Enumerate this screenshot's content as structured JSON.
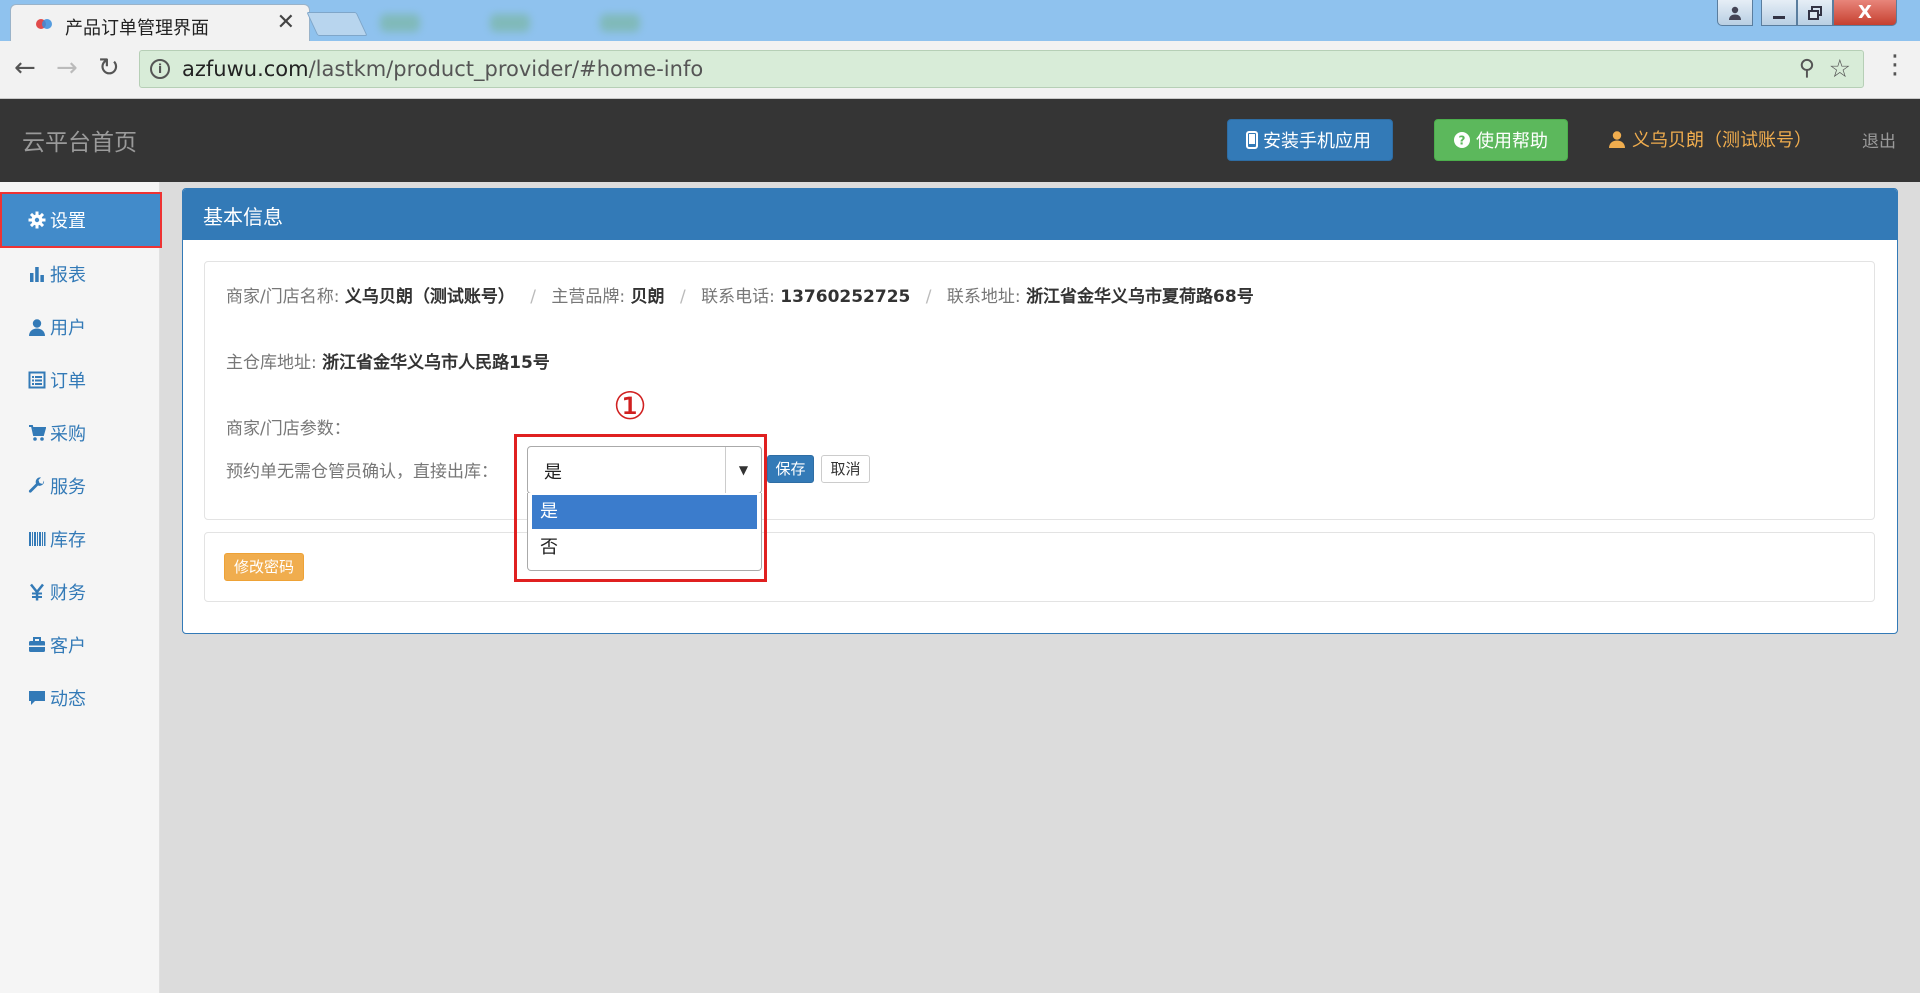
{
  "browser": {
    "tab_title": "产品订单管理界面",
    "tab_close": "✕",
    "url_host": "azfuwu.com",
    "url_path": "/lastkm/product_provider/#home-info",
    "window_close": "X"
  },
  "header": {
    "brand": "云平台首页",
    "install_button": "安装手机应用",
    "help_button": "使用帮助",
    "user": "义乌贝朗（测试账号）",
    "logout": "退出"
  },
  "sidebar": {
    "items": [
      {
        "label": "设置",
        "icon": "gear-icon"
      },
      {
        "label": "报表",
        "icon": "bar-chart-icon"
      },
      {
        "label": "用户",
        "icon": "user-icon"
      },
      {
        "label": "订单",
        "icon": "list-icon"
      },
      {
        "label": "采购",
        "icon": "cart-icon"
      },
      {
        "label": "服务",
        "icon": "wrench-icon"
      },
      {
        "label": "库存",
        "icon": "barcode-icon"
      },
      {
        "label": "财务",
        "icon": "yen-icon"
      },
      {
        "label": "客户",
        "icon": "briefcase-icon"
      },
      {
        "label": "动态",
        "icon": "comment-icon"
      }
    ]
  },
  "panel": {
    "title": "基本信息",
    "info": {
      "store_name_label": "商家/门店名称:",
      "store_name": "义乌贝朗（测试账号）",
      "brand_label": "主营品牌:",
      "brand": "贝朗",
      "phone_label": "联系电话:",
      "phone": "13760252725",
      "address_label": "联系地址:",
      "address": "浙江省金华义乌市夏荷路68号",
      "warehouse_label": "主仓库地址:",
      "warehouse": "浙江省金华义乌市人民路15号",
      "params_label": "商家/门店参数：",
      "param_setting_label": "预约单无需仓管员确认，直接出库：",
      "separator": "/"
    },
    "select": {
      "value": "是",
      "options": [
        "是",
        "否"
      ]
    },
    "save_button": "保存",
    "cancel_button": "取消",
    "change_password_button": "修改密码",
    "annotation": "①"
  },
  "colors": {
    "primary": "#337ab7",
    "success": "#5cb85c",
    "warning": "#f0ad4e",
    "header_bg": "#353535",
    "highlight": "#e02020"
  }
}
